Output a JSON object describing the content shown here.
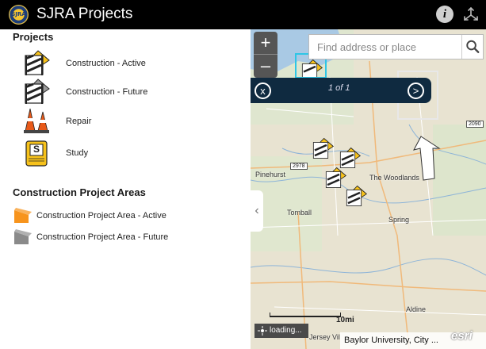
{
  "header": {
    "logo_text": "SJRA",
    "title": "SJRA Projects"
  },
  "legend": {
    "projects_title": "Projects",
    "projects": [
      {
        "label": "Construction - Active",
        "icon": "construction-active-icon"
      },
      {
        "label": "Construction - Future",
        "icon": "construction-future-icon"
      },
      {
        "label": "Repair",
        "icon": "repair-cones-icon"
      },
      {
        "label": "Study",
        "icon": "study-icon"
      }
    ],
    "areas_title": "Construction Project Areas",
    "areas": [
      {
        "label": "Construction Project Area - Active",
        "color": "#f7941d"
      },
      {
        "label": "Construction Project Area - Future",
        "color": "#8a8a8a"
      }
    ],
    "study_glyph": "S"
  },
  "map": {
    "zoom_in": "+",
    "zoom_out": "–",
    "search": {
      "placeholder": "Find address or place",
      "value": ""
    },
    "popup": {
      "count": "1 of 1",
      "close_glyph": "x",
      "next_glyph": ">"
    },
    "places": [
      "Pinehurst",
      "The Woodlands",
      "Tomball",
      "Spring",
      "Aldine",
      "Jersey Vil"
    ],
    "shields": [
      "2978",
      "2090"
    ],
    "scale_label": "10mi",
    "loading_text": "loading...",
    "attribution": "Baylor University, City ...",
    "esri": "esri"
  },
  "colors": {
    "header_bg": "#000000",
    "popup_bg": "#0f2a40",
    "active": "#f7941d",
    "future": "#8a8a8a"
  }
}
